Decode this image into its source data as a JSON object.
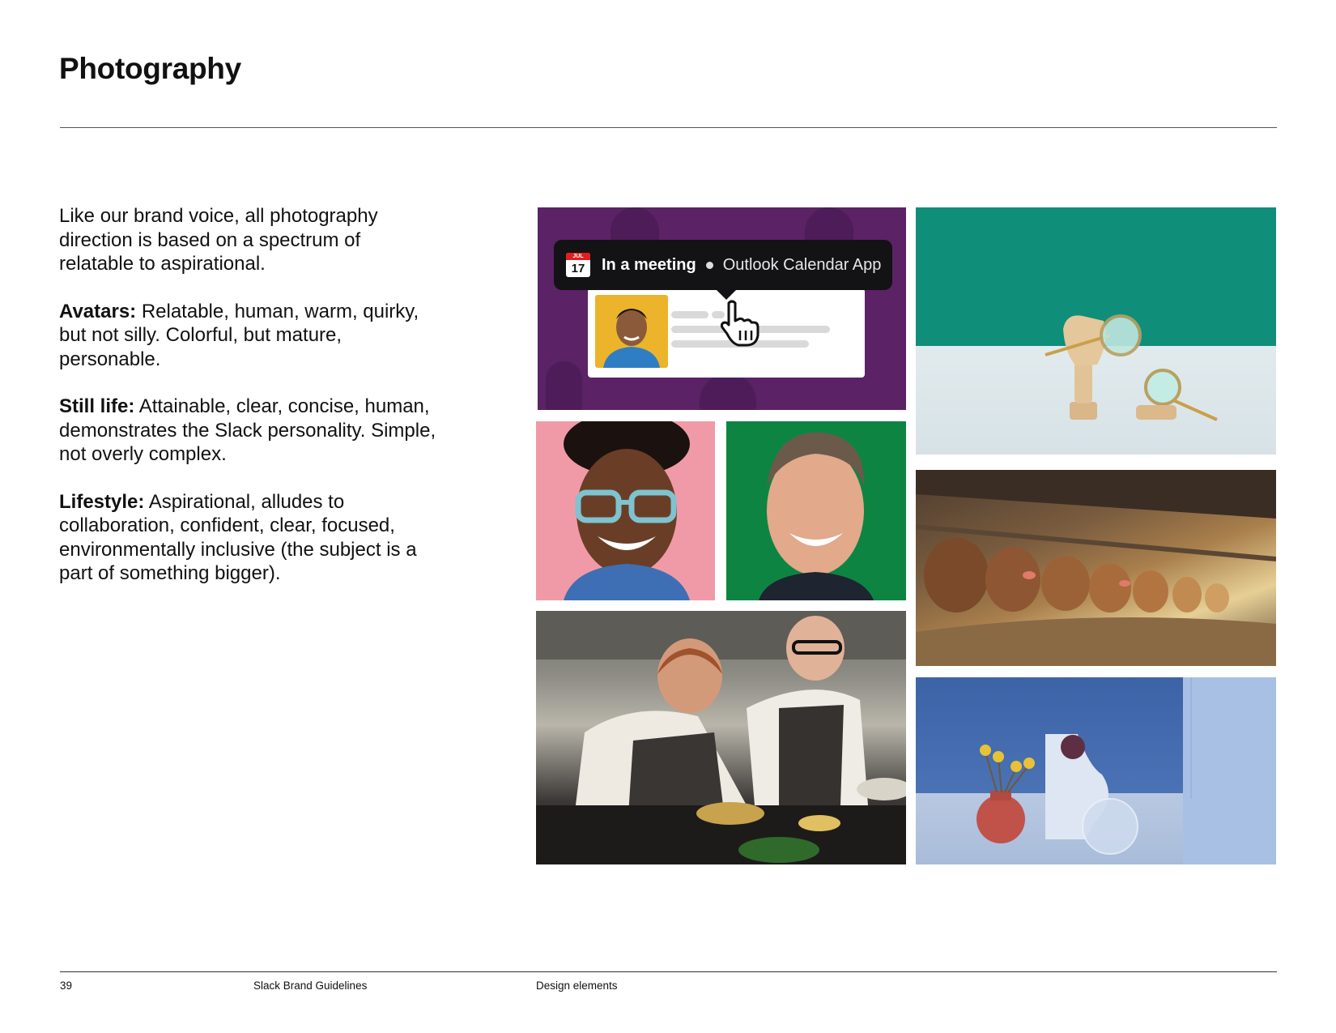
{
  "page": {
    "title": "Photography"
  },
  "copy": {
    "intro": "Like our brand voice, all photography direction is based on a spectrum of relatable to aspirational.",
    "avatars": {
      "label": "Avatars:",
      "text": " Relatable, human, warm, quirky, but not silly. Colorful, but mature, personable."
    },
    "still_life": {
      "label": "Still life:",
      "text": " Attainable, clear, concise, human, demonstrates the Slack personality. Simple, not overly complex."
    },
    "lifestyle": {
      "label": "Lifestyle:",
      "text": " Aspirational, alludes to collaboration, confident, clear, focused, environmentally inclusive (the subject is a part of something bigger)."
    }
  },
  "ui_tile": {
    "calendar_month": "JUL",
    "calendar_day": "17",
    "status": "In a meeting",
    "app": "Outlook Calendar App",
    "colors": {
      "background": "#5b2266",
      "tooltip": "#131214",
      "avatar_bg": "#ecb42b"
    }
  },
  "photos": {
    "avatar_woman_bg": "#f19aa7",
    "avatar_man_bg": "#0e8443",
    "still_life_hand_bg": "#0f8e7a",
    "still_life_vase_bg": "#3c63a6"
  },
  "footer": {
    "page_number": "39",
    "doc_title": "Slack Brand Guidelines",
    "section": "Design elements"
  }
}
